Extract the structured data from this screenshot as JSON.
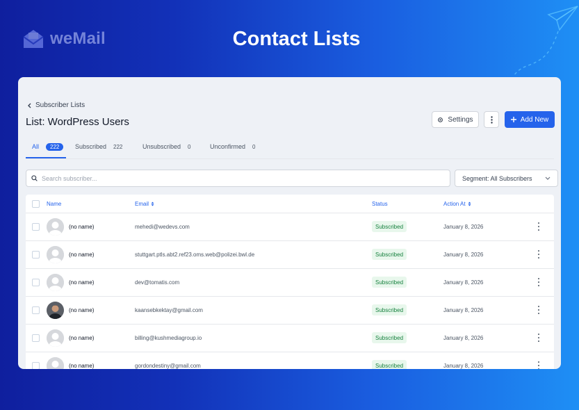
{
  "brand": {
    "name": "weMail",
    "logo_icon": "envelope-logo-icon"
  },
  "hero": {
    "title": "Contact Lists"
  },
  "header": {
    "breadcrumb": "Subscriber Lists",
    "title": "List: WordPress Users",
    "settings_label": "Settings",
    "add_label": "Add New"
  },
  "tabs": [
    {
      "label": "All",
      "count": "222"
    },
    {
      "label": "Subscribed",
      "count": "222"
    },
    {
      "label": "Unsubscribed",
      "count": "0"
    },
    {
      "label": "Unconfirmed",
      "count": "0"
    }
  ],
  "search": {
    "placeholder": "Search subscriber..."
  },
  "segment": {
    "label": "Segment: All Subscribers"
  },
  "table": {
    "columns": {
      "name": "Name",
      "email": "Email",
      "status": "Status",
      "action_at": "Action At"
    },
    "rows": [
      {
        "name": "(no name)",
        "email": "mehedi@wedevs.com",
        "status": "Subscribed",
        "date": "January 8, 2026"
      },
      {
        "name": "(no name)",
        "email": "stuttgart.ptls.abt2.ref23.oms.web@polizei.bwl.de",
        "status": "Subscribed",
        "date": "January 8, 2026"
      },
      {
        "name": "(no name)",
        "email": "dev@tomatis.com",
        "status": "Subscribed",
        "date": "January 8, 2026"
      },
      {
        "name": "(no name)",
        "email": "kaansebkektay@gmail.com",
        "status": "Subscribed",
        "date": "January 8, 2026"
      },
      {
        "name": "(no name)",
        "email": "billing@kushmediagroup.io",
        "status": "Subscribed",
        "date": "January 8, 2026"
      },
      {
        "name": "(no name)",
        "email": "gordondestiny@gmail.com",
        "status": "Subscribed",
        "date": "January 8, 2026"
      }
    ]
  },
  "colors": {
    "accent": "#2563eb",
    "status_bg": "#e8f7ec",
    "status_text": "#15803d"
  }
}
